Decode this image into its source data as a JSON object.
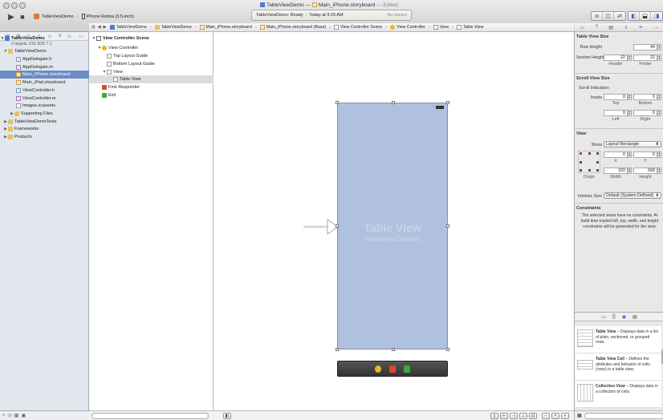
{
  "window": {
    "title_project": "TableViewDemo",
    "title_sep": "—",
    "title_file": "Main_iPhone.storyboard",
    "title_status": "— Edited"
  },
  "toolbar": {
    "scheme_name": "TableViewDemo",
    "scheme_device": "iPhone Retina (3.5-inch)",
    "activity_status": "TableViewDemo: Ready",
    "activity_time": "Today at 9:29 AM",
    "activity_issues": "No Issues"
  },
  "navigator": {
    "items": [
      {
        "label": "TableViewDemo",
        "kind": "project",
        "bold": true
      },
      {
        "label": "2 targets, iOS SDK 7.1",
        "kind": "subtitle"
      },
      {
        "label": "TableViewDemo",
        "kind": "folder"
      },
      {
        "label": "AppDelegate.h",
        "kind": "h"
      },
      {
        "label": "AppDelegate.m",
        "kind": "m"
      },
      {
        "label": "Main_iPhone.storyboard",
        "kind": "storyboard",
        "selected": true
      },
      {
        "label": "Main_iPad.storyboard",
        "kind": "storyboard"
      },
      {
        "label": "ViewController.h",
        "kind": "h"
      },
      {
        "label": "ViewController.m",
        "kind": "m"
      },
      {
        "label": "Images.xcassets",
        "kind": "file"
      },
      {
        "label": "Supporting Files",
        "kind": "folder"
      },
      {
        "label": "TableViewDemoTests",
        "kind": "folder"
      },
      {
        "label": "Frameworks",
        "kind": "folder"
      },
      {
        "label": "Products",
        "kind": "folder"
      }
    ]
  },
  "jumpbar": [
    "TableViewDemo",
    "TableViewDemo",
    "Main_iPhone.storyboard",
    "Main_iPhone.storyboard (Base)",
    "View Controller Scene",
    "View Controller",
    "View",
    "Table View"
  ],
  "outline": {
    "items": [
      {
        "label": "View Controller Scene",
        "bold": true
      },
      {
        "label": "View Controller"
      },
      {
        "label": "Top Layout Guide"
      },
      {
        "label": "Bottom Layout Guide"
      },
      {
        "label": "View"
      },
      {
        "label": "Table View",
        "selected": true
      },
      {
        "label": "First Responder"
      },
      {
        "label": "Exit"
      }
    ]
  },
  "canvas": {
    "title": "Table View",
    "subtitle": "Prototype Content"
  },
  "inspector": {
    "table_view_size": {
      "header": "Table View Size",
      "row_height_label": "Row Height",
      "row_height": "44",
      "section_height_label": "Section Height",
      "header_value": "22",
      "footer_value": "22",
      "header_label": "Header",
      "footer_label": "Footer"
    },
    "scroll_view_size": {
      "header": "Scroll View Size",
      "scroll_indicators": "Scroll Indicators",
      "insets_label": "Insets",
      "top": "0",
      "bottom": "0",
      "left": "0",
      "right": "0",
      "top_label": "Top",
      "bottom_label": "Bottom",
      "left_label": "Left",
      "right_label": "Right"
    },
    "view": {
      "header": "View",
      "show_label": "Show",
      "show_value": "Layout Rectangle",
      "x": "0",
      "y": "0",
      "x_label": "X",
      "y_label": "Y",
      "width": "320",
      "height": "568",
      "width_label": "Width",
      "height_label": "Height",
      "origin_label": "Origin",
      "intrinsic_label": "Intrinsic Size",
      "intrinsic_value": "Default (System Defined)"
    },
    "constraints": {
      "header": "Constraints",
      "text": "The selected views have no constraints. At build time explicit left, top, width, and height constraints will be generated for the view."
    }
  },
  "library": {
    "items": [
      {
        "title": "Table View",
        "desc": " – Displays data in a list of plain, sectioned, or grouped rows."
      },
      {
        "title": "Table View Cell",
        "desc": " – Defines the attributes and behavior of cells (rows) in a table view."
      },
      {
        "title": "Collection View",
        "desc": " – Displays data in a collection of cells."
      }
    ]
  }
}
